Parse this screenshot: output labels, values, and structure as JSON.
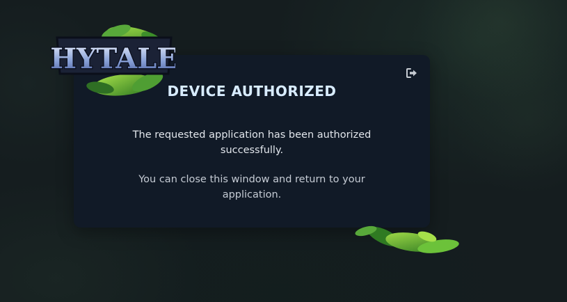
{
  "brand": {
    "logo_text": "HYTALE"
  },
  "card": {
    "title": "DEVICE AUTHORIZED",
    "message_primary": "The requested application has been authorized successfully.",
    "message_secondary": "You can close this window and return to your application.",
    "logout_icon": "logout-icon"
  },
  "colors": {
    "card_background": "#111a27",
    "title": "#d8ecff",
    "page_background": "#151d1f",
    "leaf_green": "#6cc23a"
  }
}
